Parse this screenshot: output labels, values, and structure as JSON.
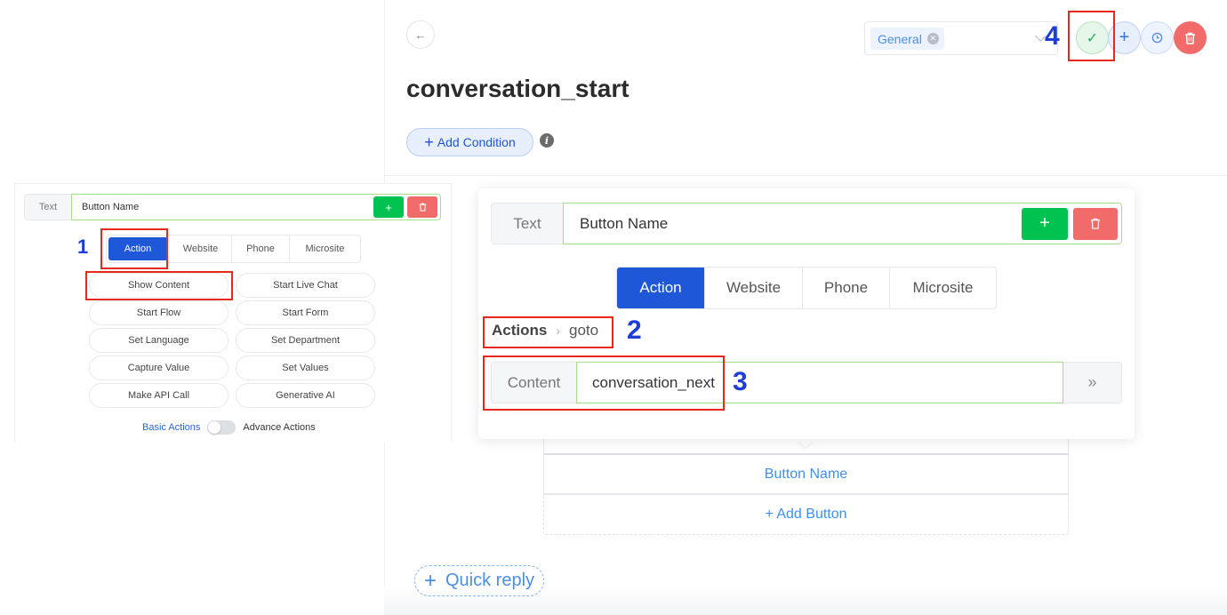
{
  "header": {
    "title": "conversation_start",
    "back_icon": "arrow-left-icon",
    "add_condition_label": "Add Condition",
    "info_icon": "info-icon",
    "tag_select": {
      "selected_tag": "General"
    },
    "actions": {
      "save_icon": "check-icon",
      "add_icon": "plus-icon",
      "history_icon": "clock-icon",
      "delete_icon": "trash-icon"
    }
  },
  "canvas": {
    "button_name": "Button Name",
    "add_button_label": "+ Add Button",
    "quick_reply_label": "Quick reply"
  },
  "popover": {
    "text_prefix": "Text",
    "text_value": "Button Name",
    "add_icon": "plus-icon",
    "delete_icon": "trash-icon",
    "tabs": [
      {
        "label": "Action",
        "active": true
      },
      {
        "label": "Website",
        "active": false
      },
      {
        "label": "Phone",
        "active": false
      },
      {
        "label": "Microsite",
        "active": false
      }
    ],
    "breadcrumb": {
      "root": "Actions",
      "current": "goto"
    },
    "content_prefix": "Content",
    "content_value": "conversation_next",
    "next_icon": "double-chevron-right-icon"
  },
  "inset": {
    "text_prefix": "Text",
    "text_value": "Button Name",
    "tabs": [
      {
        "label": "Action",
        "active": true
      },
      {
        "label": "Website",
        "active": false
      },
      {
        "label": "Phone",
        "active": false
      },
      {
        "label": "Microsite",
        "active": false
      }
    ],
    "actions": [
      "Show Content",
      "Start Live Chat",
      "Start Flow",
      "Start Form",
      "Set Language",
      "Set Department",
      "Capture Value",
      "Set Values",
      "Make API Call",
      "Generative AI"
    ],
    "toggle": {
      "left_label": "Basic Actions",
      "right_label": "Advance Actions",
      "on": false
    }
  },
  "annotations": {
    "step1": "1",
    "step2": "2",
    "step3": "3",
    "step4": "4"
  },
  "colors": {
    "primary": "#1e57d8",
    "success": "#00c250",
    "danger": "#f16b6b",
    "link": "#3f8ff0",
    "annotation_box": "#e8281a",
    "annotation_number": "#1d3fd6"
  }
}
